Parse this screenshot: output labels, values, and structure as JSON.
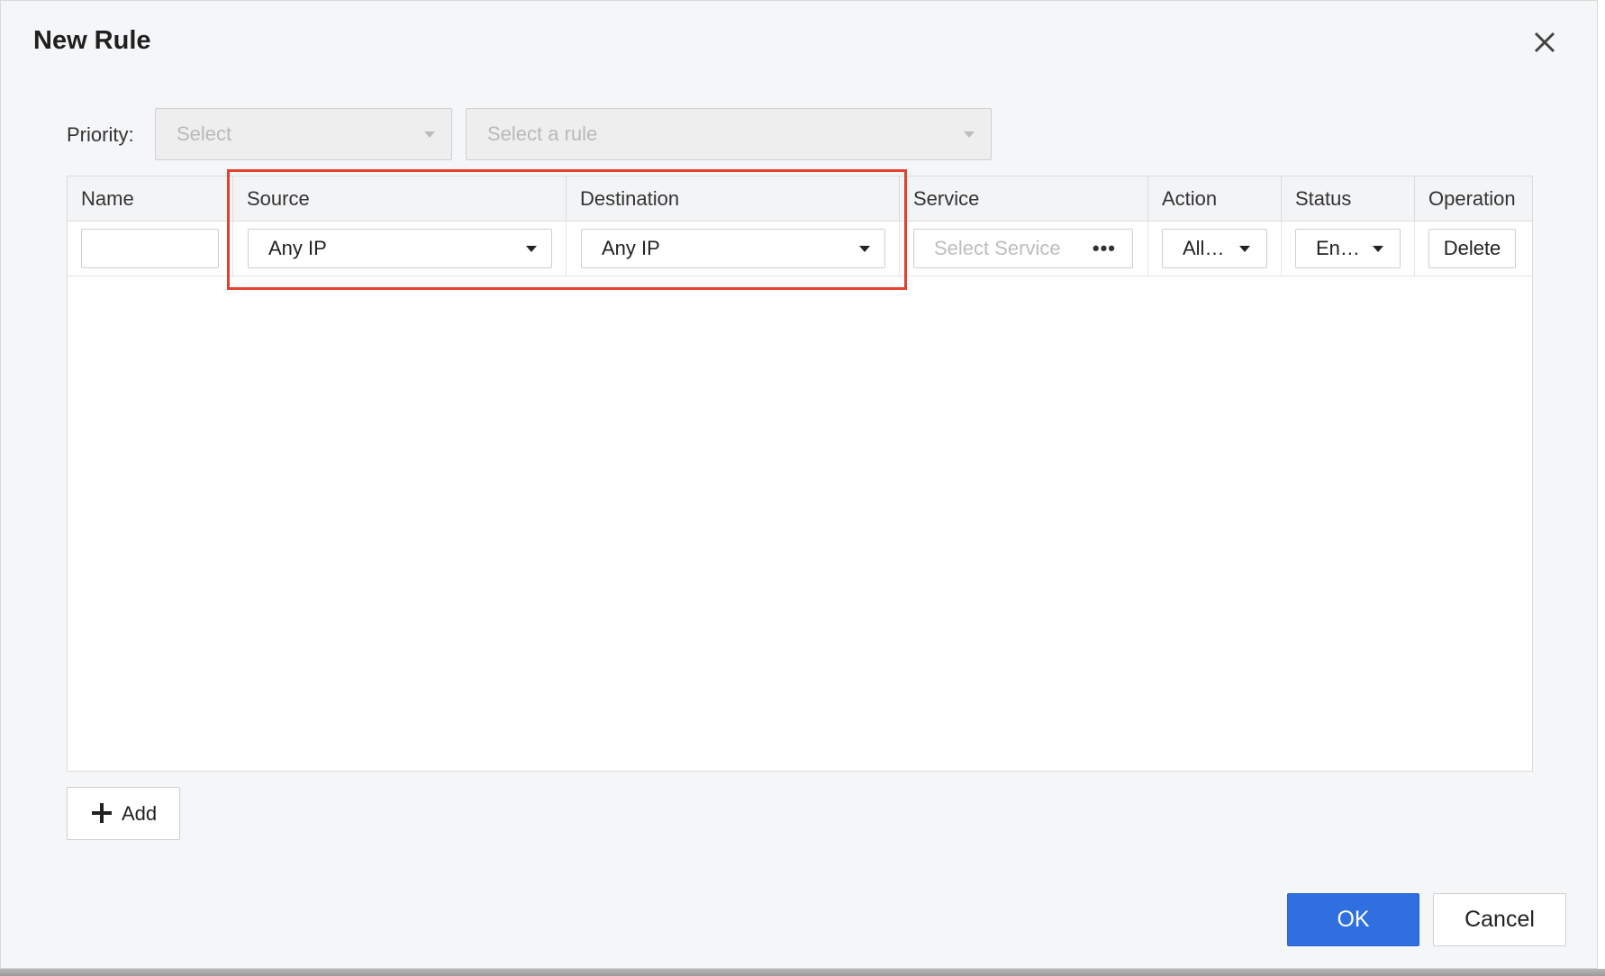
{
  "dialog": {
    "title": "New Rule",
    "close_icon": "close-icon"
  },
  "priority": {
    "label": "Priority:",
    "select_placeholder": "Select",
    "rule_placeholder": "Select a rule"
  },
  "table": {
    "columns": [
      "Name",
      "Source",
      "Destination",
      "Service",
      "Action",
      "Status",
      "Operation"
    ],
    "rows": [
      {
        "name": "",
        "source": "Any IP",
        "destination": "Any IP",
        "service_placeholder": "Select Service",
        "service_more": "•••",
        "action": "All…",
        "status": "En…",
        "operation": "Delete"
      }
    ]
  },
  "add_button": {
    "label": "Add",
    "icon": "plus-icon"
  },
  "footer": {
    "ok_label": "OK",
    "cancel_label": "Cancel"
  },
  "colors": {
    "primary": "#2f6fe0",
    "highlight": "#e4402e",
    "dialog_bg": "#f5f6f8"
  }
}
